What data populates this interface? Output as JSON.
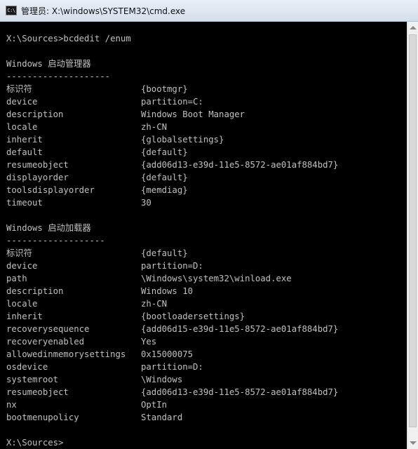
{
  "window": {
    "title": "管理员: X:\\windows\\SYSTEM32\\cmd.exe",
    "icon": "cmd-icon",
    "icon_text": "C:\\"
  },
  "console": {
    "prompt1": "X:\\Sources>bcdedit /enum",
    "manager": {
      "heading": "Windows 启动管理器",
      "separator": "--------------------",
      "entries": [
        {
          "key": "标识符",
          "value": "{bootmgr}"
        },
        {
          "key": "device",
          "value": "partition=C:"
        },
        {
          "key": "description",
          "value": "Windows Boot Manager"
        },
        {
          "key": "locale",
          "value": "zh-CN"
        },
        {
          "key": "inherit",
          "value": "{globalsettings}"
        },
        {
          "key": "default",
          "value": "{default}"
        },
        {
          "key": "resumeobject",
          "value": "{add06d13-e39d-11e5-8572-ae01af884bd7}"
        },
        {
          "key": "displayorder",
          "value": "{default}"
        },
        {
          "key": "toolsdisplayorder",
          "value": "{memdiag}"
        },
        {
          "key": "timeout",
          "value": "30"
        }
      ]
    },
    "loader": {
      "heading": "Windows 启动加载器",
      "separator": "-------------------",
      "entries": [
        {
          "key": "标识符",
          "value": "{default}"
        },
        {
          "key": "device",
          "value": "partition=D:"
        },
        {
          "key": "path",
          "value": "\\Windows\\system32\\winload.exe"
        },
        {
          "key": "description",
          "value": "Windows 10"
        },
        {
          "key": "locale",
          "value": "zh-CN"
        },
        {
          "key": "inherit",
          "value": "{bootloadersettings}"
        },
        {
          "key": "recoverysequence",
          "value": "{add06d15-e39d-11e5-8572-ae01af884bd7}"
        },
        {
          "key": "recoveryenabled",
          "value": "Yes"
        },
        {
          "key": "allowedinmemorysettings",
          "value": "0x15000075"
        },
        {
          "key": "osdevice",
          "value": "partition=D:"
        },
        {
          "key": "systemroot",
          "value": "\\Windows"
        },
        {
          "key": "resumeobject",
          "value": "{add06d13-e39d-11e5-8572-ae01af884bd7}"
        },
        {
          "key": "nx",
          "value": "OptIn"
        },
        {
          "key": "bootmenupolicy",
          "value": "Standard"
        }
      ]
    },
    "prompt2": "X:\\Sources>"
  }
}
